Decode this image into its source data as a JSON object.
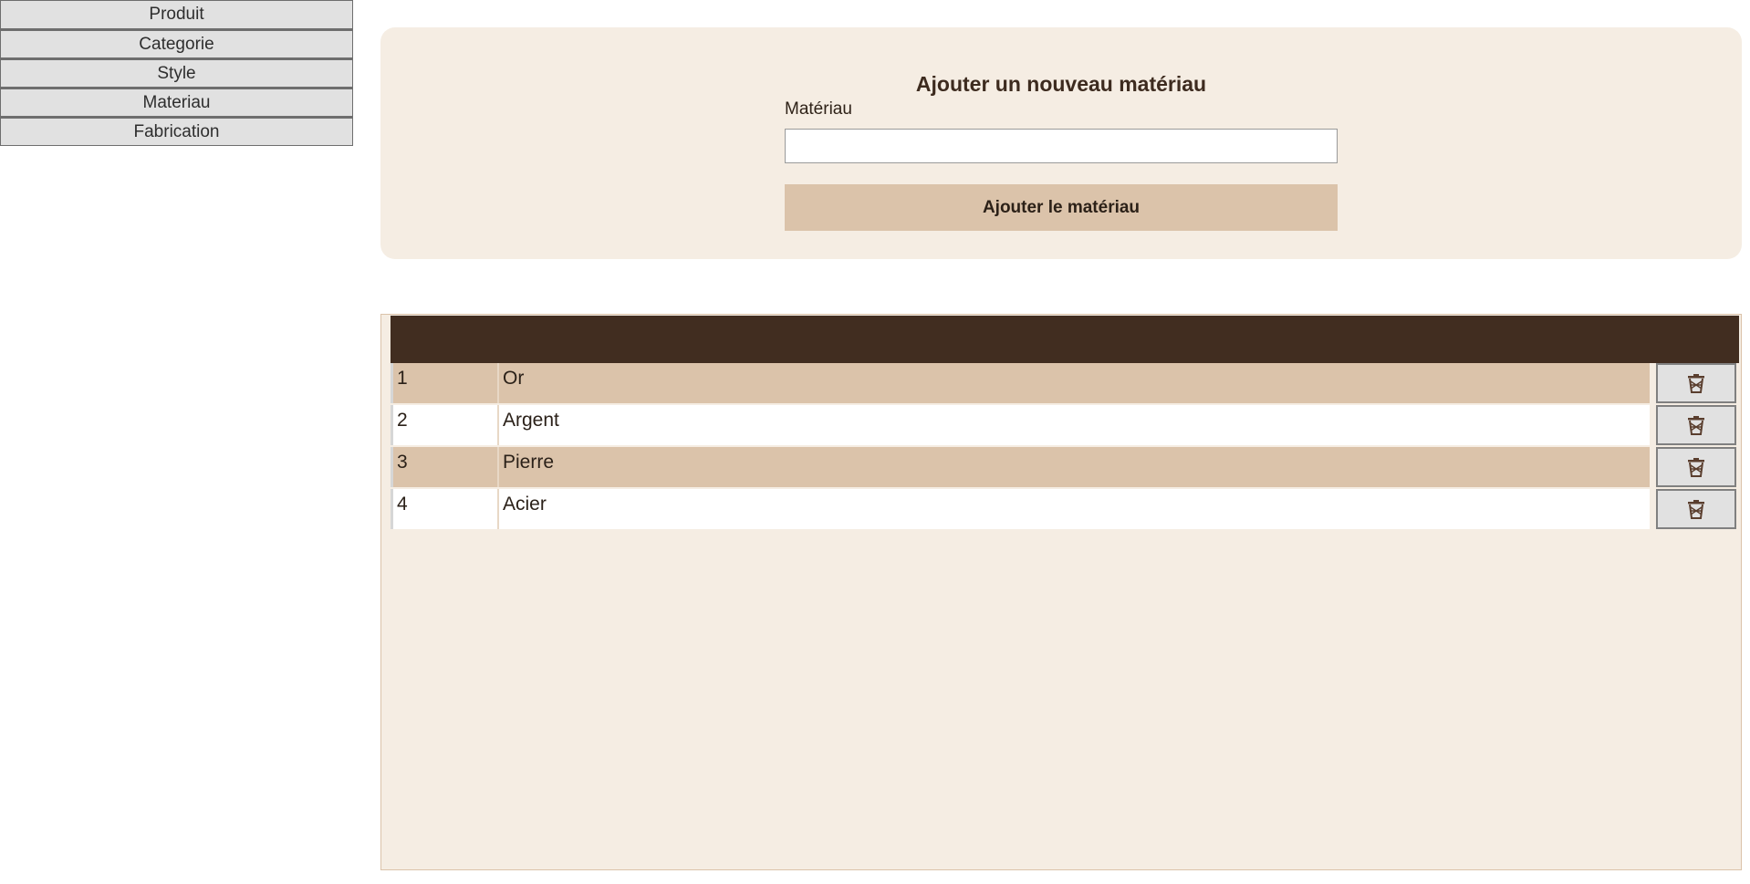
{
  "nav": {
    "items": [
      "Produit",
      "Categorie",
      "Style",
      "Materiau",
      "Fabrication"
    ]
  },
  "form": {
    "title": "Ajouter un nouveau matériau",
    "field_label": "Matériau",
    "field_value": "",
    "submit_label": "Ajouter le matériau"
  },
  "table": {
    "rows": [
      {
        "id": "1",
        "name": "Or"
      },
      {
        "id": "2",
        "name": "Argent"
      },
      {
        "id": "3",
        "name": "Pierre"
      },
      {
        "id": "4",
        "name": "Acier"
      }
    ],
    "row_action_icon": "trash-icon"
  },
  "colors": {
    "header": "#412d20",
    "accent": "#dbc3aa",
    "panel": "#f5ede3",
    "nav_button": "#e1e1e1"
  }
}
